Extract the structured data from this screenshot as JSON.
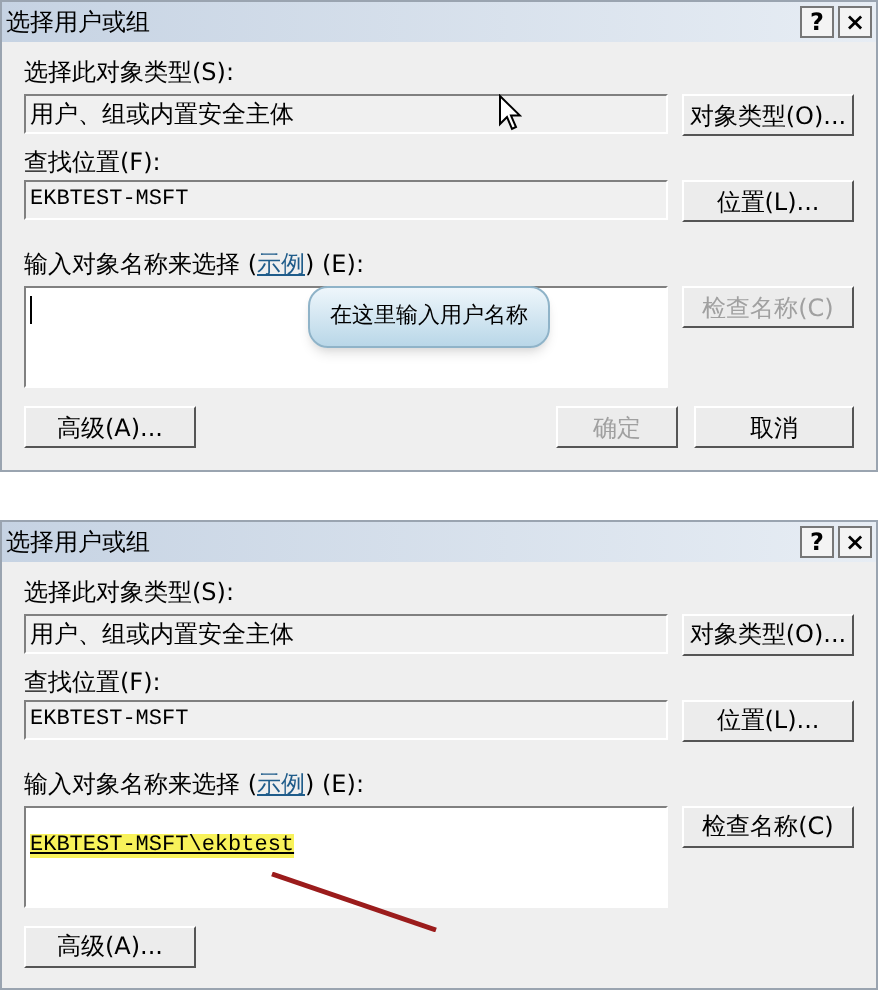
{
  "dialogs": [
    {
      "title": "选择用户或组",
      "title_buttons": [
        "?",
        "×"
      ],
      "object_type_label": "选择此对象类型(S):",
      "object_type_value": "用户、组或内置安全主体",
      "object_types_button": "对象类型(O)...",
      "location_label": "查找位置(F):",
      "location_value": "EKBTEST-MSFT",
      "location_button": "位置(L)...",
      "names_label_before": "输入对象名称来选择 (",
      "example_link": "示例",
      "names_label_after": ") (E):",
      "caret": true,
      "cursor": true,
      "tooltip": "在这里输入用户名称",
      "check_names_button": {
        "label": "检查名称(C)",
        "disabled": true
      },
      "advanced_button": "高级(A)...",
      "buttons": [
        {
          "label": "确定",
          "disabled": true
        },
        {
          "label": "取消",
          "disabled": false
        }
      ]
    },
    {
      "title": "选择用户或组",
      "title_buttons": [
        "?",
        "×"
      ],
      "object_type_label": "选择此对象类型(S):",
      "object_type_value": "用户、组或内置安全主体",
      "object_types_button": "对象类型(O)...",
      "location_label": "查找位置(F):",
      "location_value": "EKBTEST-MSFT",
      "location_button": "位置(L)...",
      "names_label_before": "输入对象名称来选择 (",
      "example_link": "示例",
      "names_label_after": ") (E):",
      "names_value": "EKBTEST-MSFT\\ekbtest",
      "highlighted": true,
      "annotation_arrow": true,
      "check_names_button": {
        "label": "检查名称(C)",
        "disabled": false
      },
      "advanced_button": "高级(A)..."
    }
  ]
}
